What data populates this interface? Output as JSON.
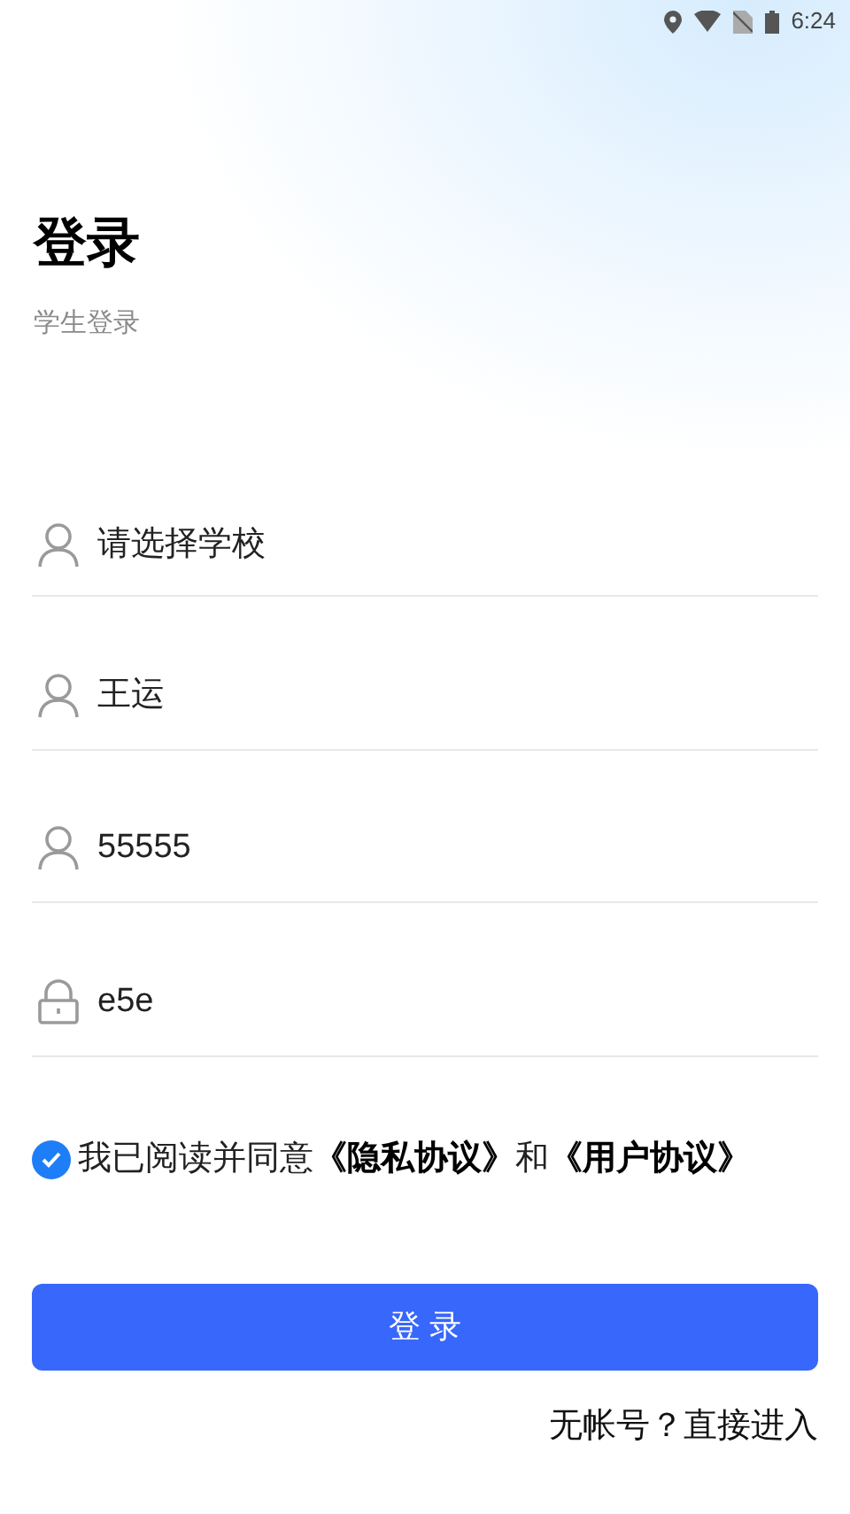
{
  "status_bar": {
    "time": "6:24"
  },
  "title": "登录",
  "subtitle": "学生登录",
  "fields": [
    {
      "kind": "text",
      "value": "请选择学校"
    },
    {
      "kind": "text",
      "value": "王运"
    },
    {
      "kind": "text",
      "value": "55555"
    },
    {
      "kind": "password",
      "value": "e5e"
    }
  ],
  "agreement": {
    "checked": true,
    "text": "我已阅读并同意",
    "privacy_link": "《隐私协议》",
    "joiner": "和",
    "user_link": "《用户协议》"
  },
  "login_button": "登 录",
  "guest_link": "无帐号？直接进入"
}
